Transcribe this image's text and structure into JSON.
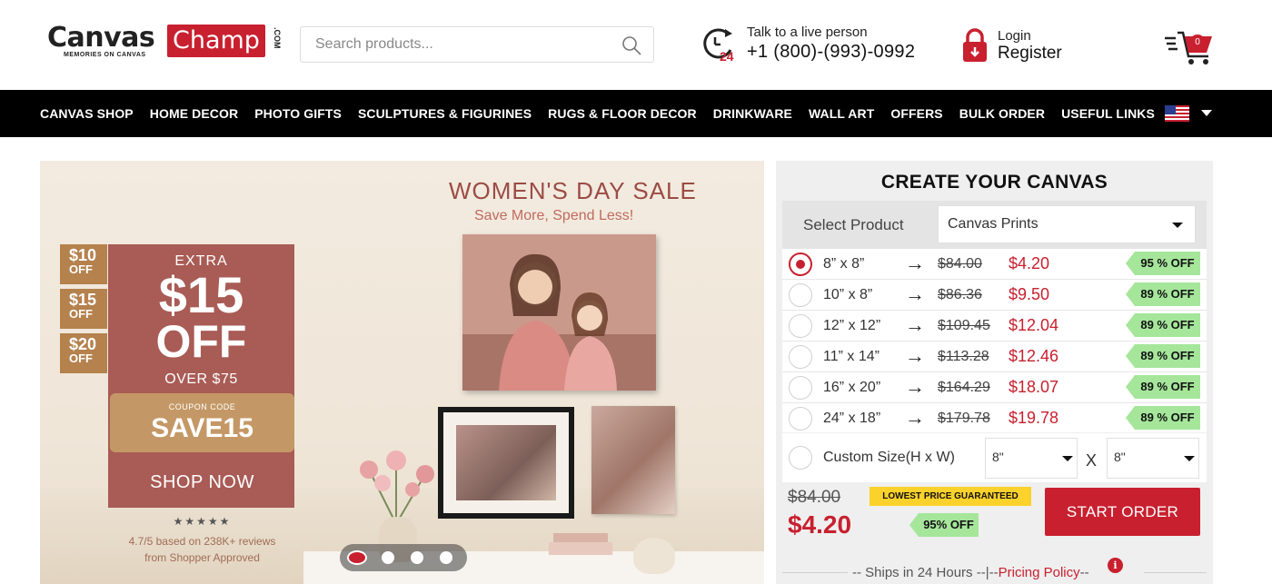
{
  "header": {
    "logo_word1": "Canvas",
    "logo_word2": "Champ",
    "logo_com": ".COM",
    "logo_tagline": "MEMORIES ON CANVAS",
    "search_placeholder": "Search products...",
    "phone_line1": "Talk to a live person",
    "phone_number": "+1 (800)-(993)-0992",
    "login_label": "Login",
    "register_label": "Register",
    "cart_count": "0",
    "icons": [
      "search-icon",
      "clock-24-icon",
      "lock-icon",
      "cart-icon"
    ]
  },
  "nav": {
    "items": [
      "CANVAS SHOP",
      "HOME DECOR",
      "PHOTO GIFTS",
      "SCULPTURES & FIGURINES",
      "RUGS & FLOOR DECOR",
      "DRINKWARE",
      "WALL ART",
      "OFFERS",
      "BULK ORDER",
      "USEFUL LINKS"
    ],
    "country_flag": "us-flag-icon"
  },
  "banner": {
    "title": "WOMEN'S DAY SALE",
    "subtitle": "Save More, Spend Less!",
    "tabs": [
      {
        "amount": "$10",
        "label": "OFF"
      },
      {
        "amount": "$15",
        "label": "OFF"
      },
      {
        "amount": "$20",
        "label": "OFF"
      }
    ],
    "extra": "EXTRA",
    "amount": "$15",
    "off": "OFF",
    "over": "OVER $75",
    "coupon_label": "COUPON CODE",
    "coupon_code": "SAVE15",
    "shop_now": "SHOP NOW",
    "stars": "★★★★★",
    "review_line1": "4.7/5 based on 238K+ reviews",
    "review_line2": "from Shopper Approved",
    "slides": 4,
    "active_slide": 1
  },
  "panel": {
    "title": "CREATE YOUR CANVAS",
    "select_label": "Select Product",
    "selected_product": "Canvas Prints",
    "arrow": "→",
    "sizes": [
      {
        "size": "8” x 8”",
        "old": "$84.00",
        "new": "$4.20",
        "off": "95 % OFF",
        "selected": true
      },
      {
        "size": "10” x 8”",
        "old": "$86.36",
        "new": "$9.50",
        "off": "89 % OFF",
        "selected": false
      },
      {
        "size": "12” x 12”",
        "old": "$109.45",
        "new": "$12.04",
        "off": "89 % OFF",
        "selected": false
      },
      {
        "size": "11” x 14”",
        "old": "$113.28",
        "new": "$12.46",
        "off": "89 % OFF",
        "selected": false
      },
      {
        "size": "16” x 20”",
        "old": "$164.29",
        "new": "$18.07",
        "off": "89 % OFF",
        "selected": false
      },
      {
        "size": "24” x 18”",
        "old": "$179.78",
        "new": "$19.78",
        "off": "89 % OFF",
        "selected": false
      }
    ],
    "custom_label": "Custom Size(H x W)",
    "custom_h": "8\"",
    "custom_x": "X",
    "custom_w": "8\"",
    "total_old": "$84.00",
    "total_new": "$4.20",
    "lowest_price": "LOWEST PRICE GUARANTEED",
    "total_off": "95% OFF",
    "start_order": "START ORDER",
    "ships_text": "-- Ships in 24 Hours --|--",
    "pricing_policy": "Pricing Policy",
    "ships_tail": "--",
    "info_glyph": "i"
  },
  "colors": {
    "brand_red": "#c8202f",
    "promo_rose": "#a95b55",
    "promo_tan": "#b5814d",
    "discount_green": "#a5e69b",
    "guarantee_yellow": "#fbd12b"
  }
}
